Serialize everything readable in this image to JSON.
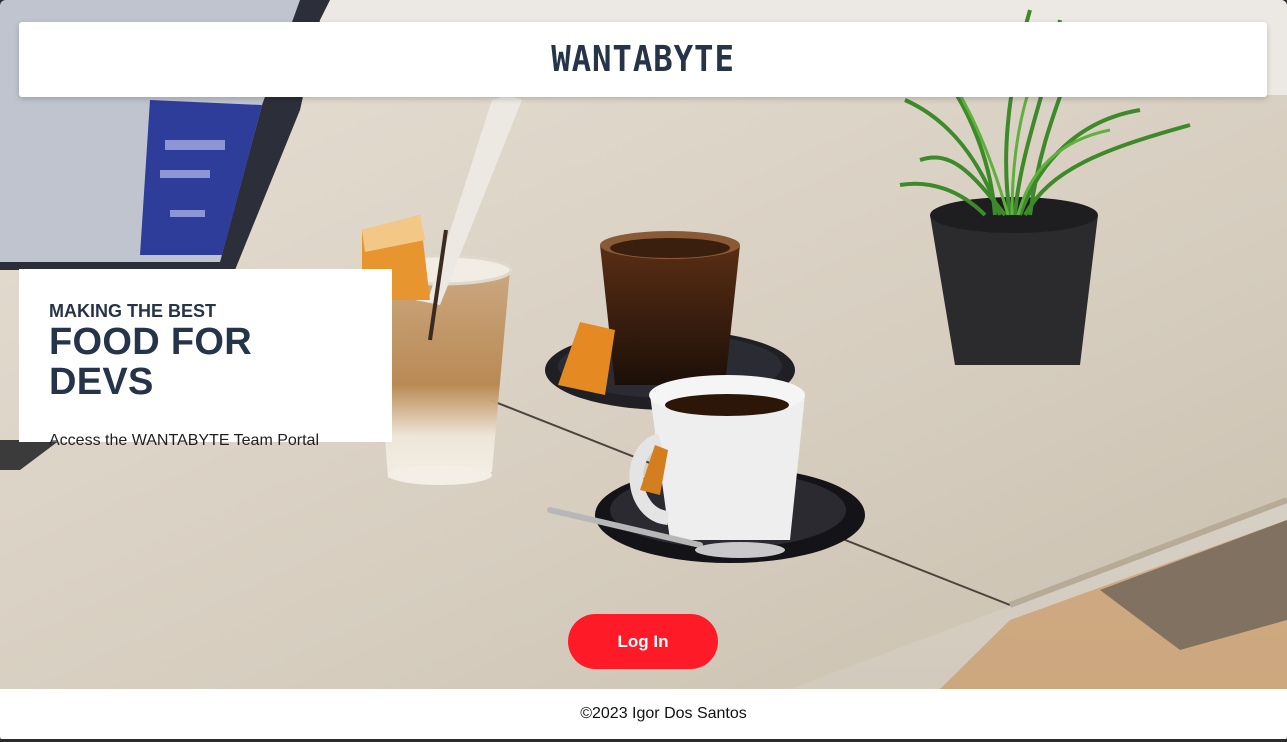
{
  "header": {
    "logo": "WANTABYTE"
  },
  "hero": {
    "kicker": "MAKING THE BEST",
    "title": "FOOD FOR DEVS",
    "subtitle": "Access the WANTABYTE Team Portal",
    "login_label": "Log In"
  },
  "footer": {
    "copyright": "©2023 Igor Dos Santos"
  },
  "colors": {
    "brand_navy": "#26344a",
    "login_red": "#ff1a28",
    "card_bg": "#ffffff"
  }
}
